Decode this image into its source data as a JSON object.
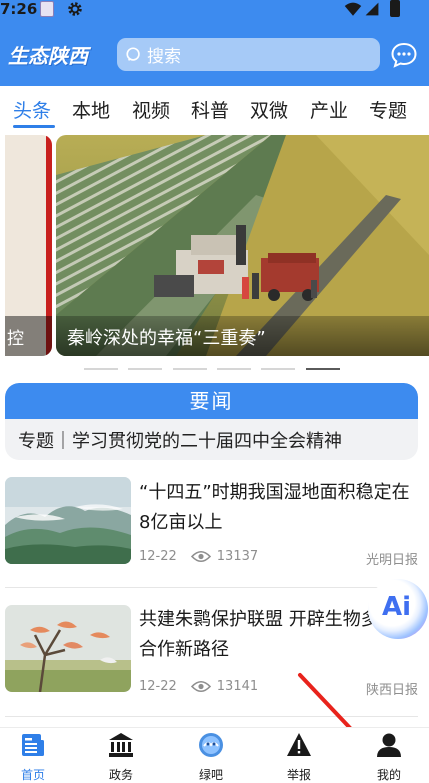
{
  "status_bar": {
    "time": "7:26"
  },
  "header": {
    "logo": "生态陕西",
    "search_placeholder": "搜索"
  },
  "tabs": [
    {
      "label": "头条",
      "active": true
    },
    {
      "label": "本地"
    },
    {
      "label": "视频"
    },
    {
      "label": "科普"
    },
    {
      "label": "双微"
    },
    {
      "label": "产业"
    },
    {
      "label": "专题"
    }
  ],
  "carousel": {
    "prev_caption": "控",
    "caption": "秦岭深处的幸福“三重奏”",
    "slide_count": 6,
    "active_index": 5
  },
  "news_box": {
    "title": "要闻",
    "headline": "专题｜学习贯彻党的二十届四中全会精神"
  },
  "articles": [
    {
      "title": "“十四五”时期我国湿地面积稳定在8亿亩以上",
      "date": "12-22",
      "views": "13137",
      "source": "光明日报"
    },
    {
      "title": "共建朱鹮保护联盟 开辟生物多样性合作新路径",
      "date": "12-22",
      "views": "13141",
      "source": "陕西日报"
    }
  ],
  "ai_button": {
    "label": "Ai"
  },
  "bottom_nav": [
    {
      "label": "首页",
      "icon": "news-icon",
      "active": true
    },
    {
      "label": "政务",
      "icon": "government-icon"
    },
    {
      "label": "绿吧",
      "icon": "green-bar-icon"
    },
    {
      "label": "举报",
      "icon": "warning-icon"
    },
    {
      "label": "我的",
      "icon": "user-icon"
    }
  ],
  "colors": {
    "brand_blue": "#3d8bef",
    "tab_active": "#2f7fe8",
    "annotation_red": "#e8231c"
  }
}
